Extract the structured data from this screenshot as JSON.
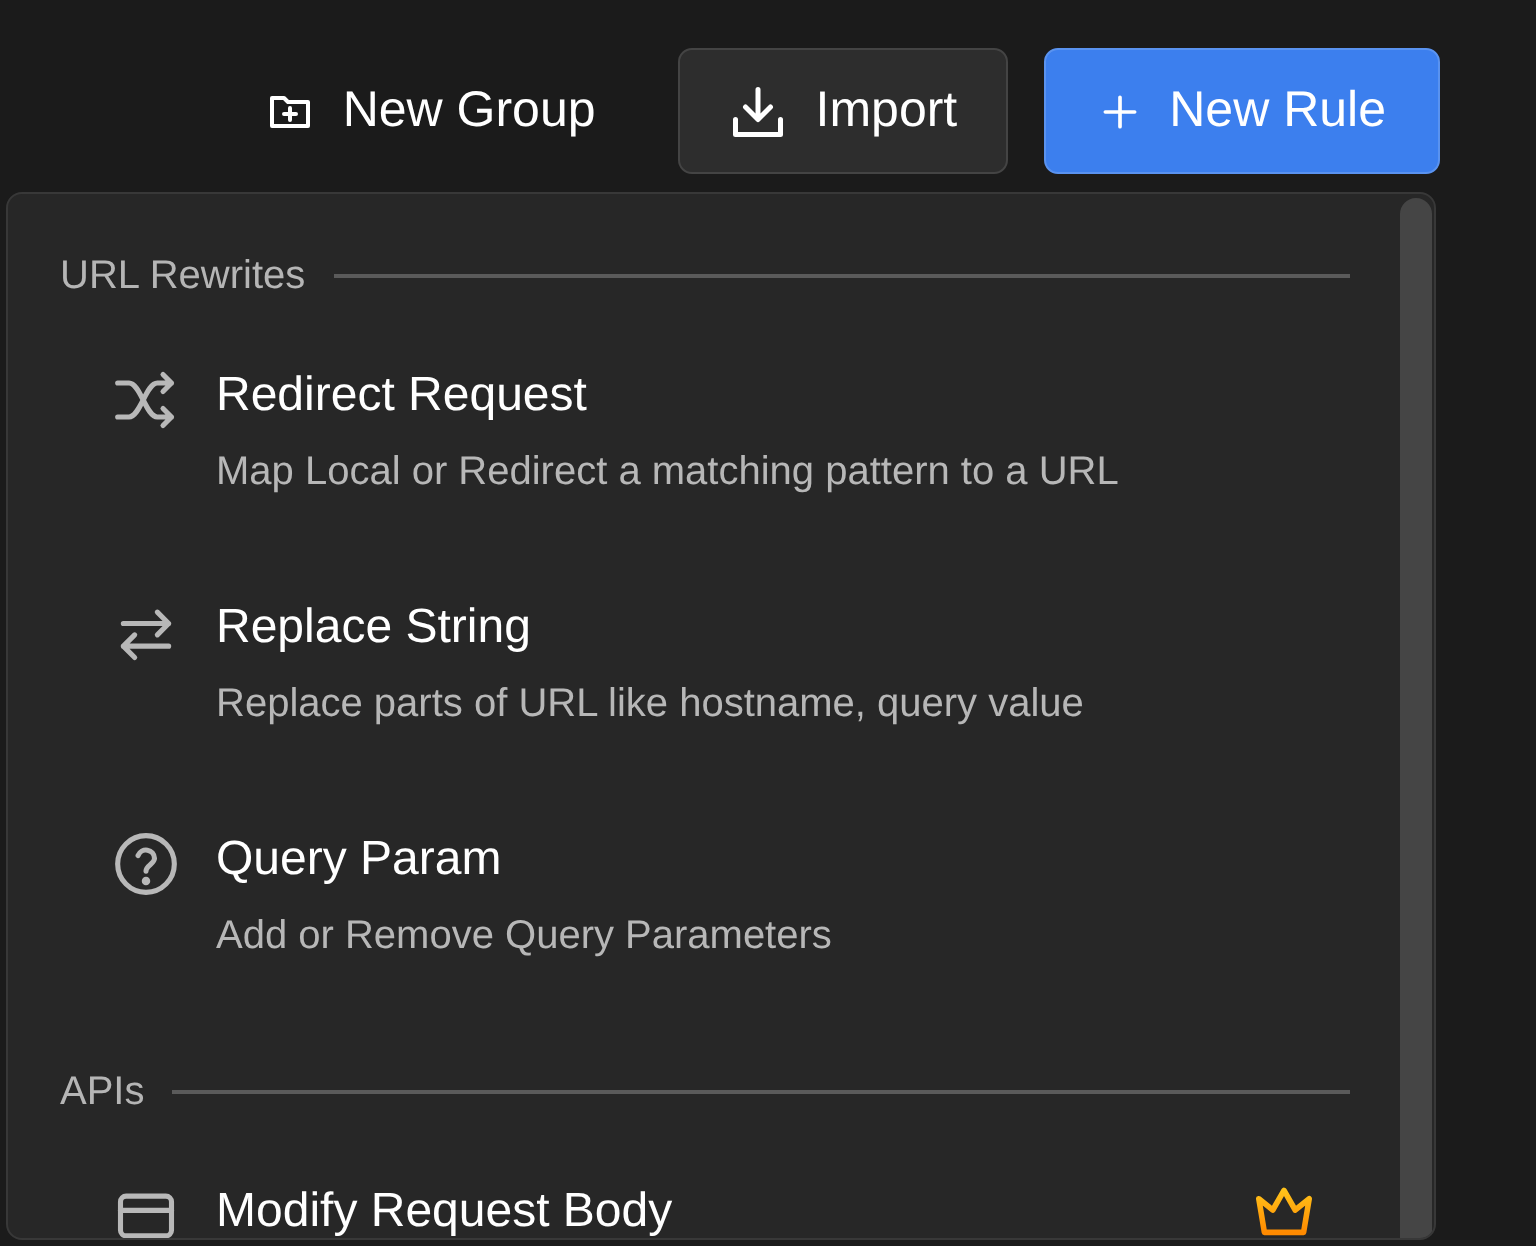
{
  "toolbar": {
    "buttons": [
      {
        "label": "New Group",
        "kind": "plain"
      },
      {
        "label": "Import",
        "kind": "outline"
      },
      {
        "label": "New Rule",
        "kind": "primary"
      }
    ]
  },
  "menu": {
    "sections": [
      {
        "title": "URL Rewrites",
        "items": [
          {
            "kind": "redirect",
            "title": "Redirect Request",
            "description": "Map Local or Redirect a matching pattern to a URL",
            "premium": false
          },
          {
            "kind": "replace",
            "title": "Replace String",
            "description": "Replace parts of URL like hostname, query value",
            "premium": false
          },
          {
            "kind": "query",
            "title": "Query Param",
            "description": "Add or Remove Query Parameters",
            "premium": false
          }
        ]
      },
      {
        "title": "APIs",
        "items": [
          {
            "kind": "body",
            "title": "Modify Request Body",
            "premium": true
          }
        ]
      }
    ]
  }
}
